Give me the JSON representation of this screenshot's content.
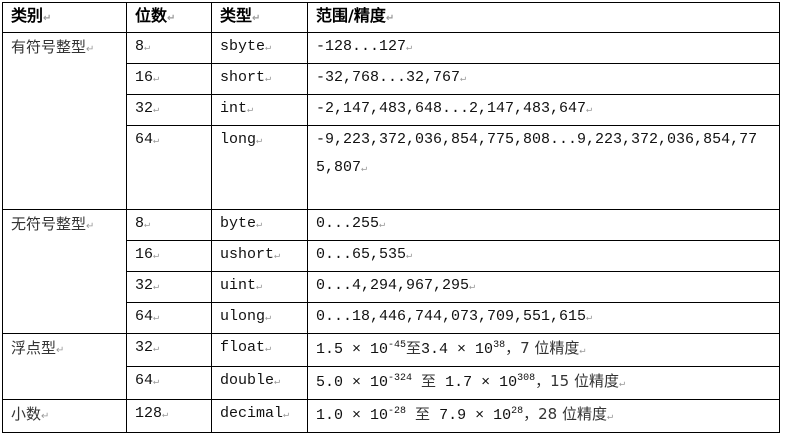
{
  "headers": [
    "类别",
    "位数",
    "类型",
    "范围/精度"
  ],
  "groups": [
    {
      "category": "有符号整型",
      "rows": [
        {
          "bits": "8",
          "type": "sbyte",
          "range": "-128...127"
        },
        {
          "bits": "16",
          "type": "short",
          "range": "-32,768...32,767"
        },
        {
          "bits": "32",
          "type": "int",
          "range": "-2,147,483,648...2,147,483,647"
        },
        {
          "bits": "64",
          "type": "long",
          "range": "-9,223,372,036,854,775,808...9,223,372,036,854,775,807"
        }
      ]
    },
    {
      "category": "无符号整型",
      "rows": [
        {
          "bits": "8",
          "type": "byte",
          "range": "0...255"
        },
        {
          "bits": "16",
          "type": "ushort",
          "range": "0...65,535"
        },
        {
          "bits": "32",
          "type": "uint",
          "range": "0...4,294,967,295"
        },
        {
          "bits": "64",
          "type": "ulong",
          "range": "0...18,446,744,073,709,551,615"
        }
      ]
    },
    {
      "category": "浮点型",
      "rows": [
        {
          "bits": "32",
          "type": "float",
          "m1": "1.5 × 10",
          "e1": "-45",
          "to": "至",
          "m2": "3.4 × 10",
          "e2": "38",
          "prec": "，7 位精度"
        },
        {
          "bits": "64",
          "type": "double",
          "m1": "5.0 × 10",
          "e1": "-324",
          "to": "至",
          "m2": "1.7 × 10",
          "e2": "308",
          "prec": "，15 位精度"
        }
      ]
    },
    {
      "category": "小数",
      "rows": [
        {
          "bits": "128",
          "type": "decimal",
          "m1": "1.0 × 10",
          "e1": "-28",
          "to": "至",
          "m2": "7.9 × 10",
          "e2": "28",
          "prec": "，28 位精度"
        }
      ]
    }
  ]
}
